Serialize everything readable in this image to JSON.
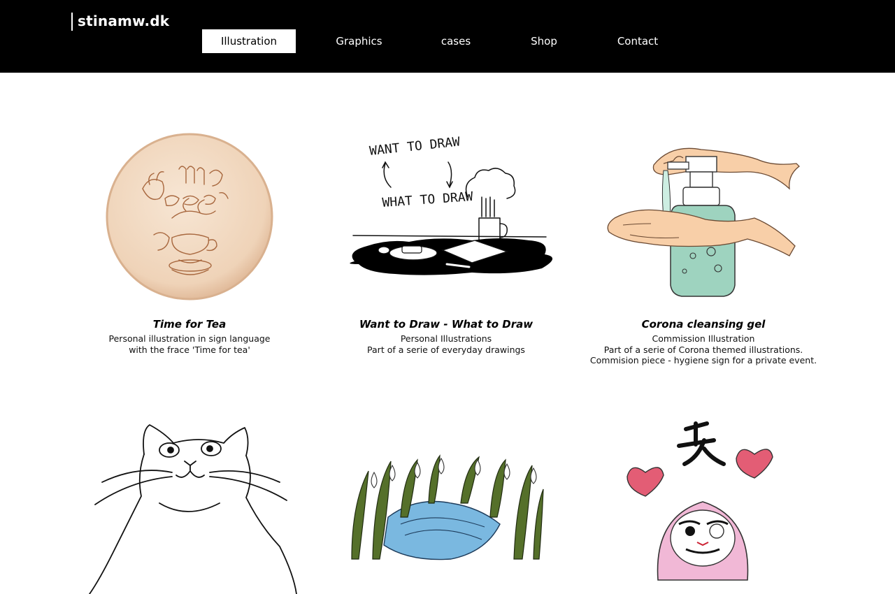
{
  "site": {
    "logo": "stinamw.dk"
  },
  "nav": {
    "items": [
      {
        "label": "Illustration",
        "active": true
      },
      {
        "label": "Graphics",
        "active": false
      },
      {
        "label": "cases",
        "active": false
      },
      {
        "label": "Shop",
        "active": false
      },
      {
        "label": "Contact",
        "active": false
      }
    ]
  },
  "gallery": {
    "items": [
      {
        "title": "Time for Tea",
        "lines": [
          "Personal illustration in sign language",
          "with the frace 'Time for tea'"
        ]
      },
      {
        "title": "Want to Draw - What to Draw",
        "lines": [
          "Personal Illustrations",
          "Part of a serie of everyday drawings"
        ],
        "art_text": [
          "WANT TO DRAW",
          "WHAT TO DRAW"
        ]
      },
      {
        "title": "Corona cleansing gel",
        "lines": [
          "Commission Illustration",
          "Part of a serie of Corona themed illustrations.",
          "Commision piece - hygiene sign for a private event."
        ]
      },
      {
        "title": "",
        "lines": []
      },
      {
        "title": "",
        "lines": []
      },
      {
        "title": "",
        "lines": []
      }
    ]
  },
  "colors": {
    "header_bg": "#000000",
    "nav_active_bg": "#ffffff",
    "wood": "#f2dcc6",
    "gel": "#9ed3bf",
    "skin": "#f8cfa8",
    "daruma": "#f1b8d6",
    "heart": "#e35d75"
  }
}
